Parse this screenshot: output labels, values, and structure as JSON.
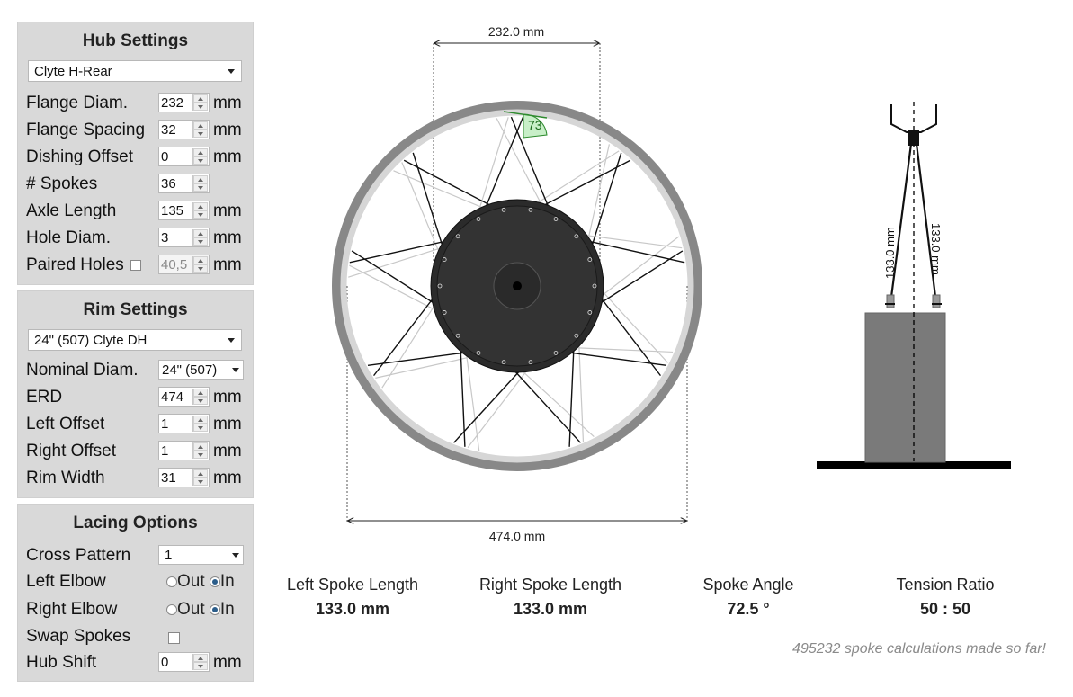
{
  "hub": {
    "title": "Hub Settings",
    "preset": "Clyte H-Rear",
    "flange_diam": {
      "label": "Flange Diam.",
      "value": "232",
      "unit": "mm"
    },
    "flange_spacing": {
      "label": "Flange Spacing",
      "value": "32",
      "unit": "mm"
    },
    "dishing_offset": {
      "label": "Dishing Offset",
      "value": "0",
      "unit": "mm"
    },
    "spokes": {
      "label": "# Spokes",
      "value": "36"
    },
    "axle_length": {
      "label": "Axle Length",
      "value": "135",
      "unit": "mm"
    },
    "hole_diam": {
      "label": "Hole Diam.",
      "value": "3",
      "unit": "mm"
    },
    "paired_holes": {
      "label": "Paired Holes",
      "value": "40,5",
      "unit": "mm"
    }
  },
  "rim": {
    "title": "Rim Settings",
    "preset": "24\" (507) Clyte DH",
    "nominal_diam": {
      "label": "Nominal Diam.",
      "value": "24\" (507)"
    },
    "erd": {
      "label": "ERD",
      "value": "474",
      "unit": "mm"
    },
    "left_offset": {
      "label": "Left Offset",
      "value": "1",
      "unit": "mm"
    },
    "right_offset": {
      "label": "Right Offset",
      "value": "1",
      "unit": "mm"
    },
    "rim_width": {
      "label": "Rim Width",
      "value": "31",
      "unit": "mm"
    }
  },
  "lacing": {
    "title": "Lacing Options",
    "cross_pattern": {
      "label": "Cross Pattern",
      "value": "1"
    },
    "left_elbow": {
      "label": "Left Elbow",
      "out": "Out",
      "in": "In"
    },
    "right_elbow": {
      "label": "Right Elbow",
      "out": "Out",
      "in": "In"
    },
    "swap_spokes": {
      "label": "Swap Spokes"
    },
    "hub_shift": {
      "label": "Hub Shift",
      "value": "0",
      "unit": "mm"
    }
  },
  "diagram": {
    "flange_dim": "232.0 mm",
    "erd_dim": "474.0 mm",
    "angle_label": "73",
    "left_side_dim": "133.0 mm",
    "right_side_dim": "133.0 mm"
  },
  "results": {
    "left_spoke": {
      "label": "Left Spoke Length",
      "value": "133.0 mm"
    },
    "right_spoke": {
      "label": "Right Spoke Length",
      "value": "133.0 mm"
    },
    "spoke_angle": {
      "label": "Spoke Angle",
      "value": "72.5 °"
    },
    "tension_ratio": {
      "label": "Tension Ratio",
      "value": "50 : 50"
    }
  },
  "counter": "495232 spoke calculations made so far!",
  "colors": {
    "panel": "#d9d9d9",
    "hub": "#333333",
    "rim_outer": "#888888",
    "rim_inner": "#d6d6d6",
    "angle": "#2e8b2e"
  }
}
